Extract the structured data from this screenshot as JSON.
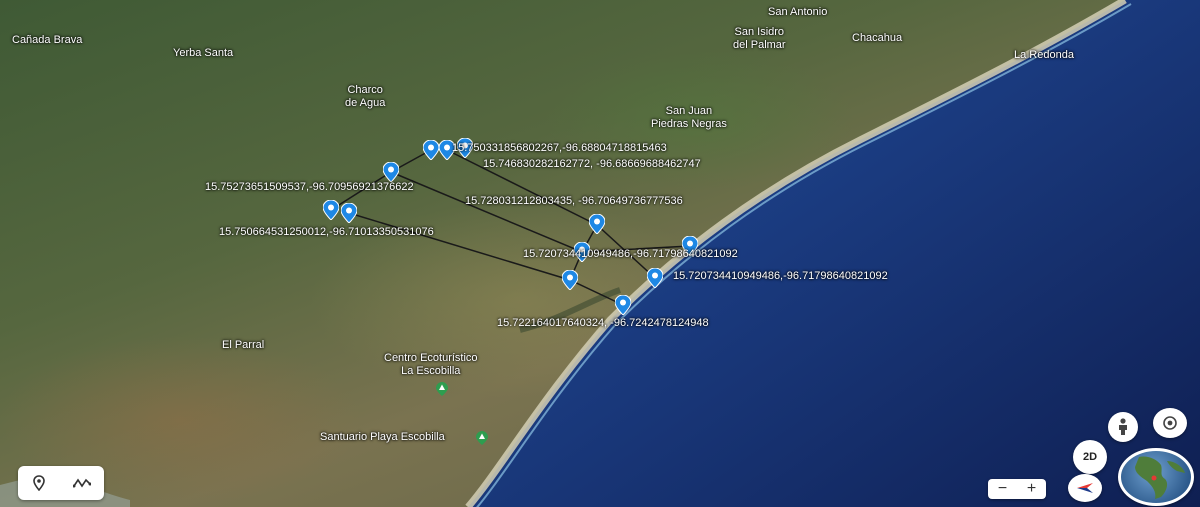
{
  "map": {
    "places": [
      {
        "id": "canada-brava",
        "text": "Cañada Brava"
      },
      {
        "id": "yerba-santa",
        "text": "Yerba Santa"
      },
      {
        "id": "charco-de-agua",
        "text": "Charco\nde Agua"
      },
      {
        "id": "san-antonio",
        "text": "San Antonio"
      },
      {
        "id": "san-isidro",
        "text": "San Isidro\ndel Palmar"
      },
      {
        "id": "chacahua",
        "text": "Chacahua"
      },
      {
        "id": "la-redonda",
        "text": "La Redonda"
      },
      {
        "id": "san-juan",
        "text": "San Juan\nPiedras Negras"
      },
      {
        "id": "el-parral",
        "text": "El Parral"
      },
      {
        "id": "centro-ecoturistico",
        "text": "Centro Ecoturístico\nLa Escobilla"
      },
      {
        "id": "santuario",
        "text": "Santuario Playa Escobilla"
      }
    ],
    "markers": [
      {
        "id": "m1",
        "label": "15.750331856802267,-96.68804718815463"
      },
      {
        "id": "m2",
        "label": "15.746830282162772, -96.68669688462747"
      },
      {
        "id": "m3",
        "label": "15.75273651509537,-96.70956921376622"
      },
      {
        "id": "m4",
        "label": "15.728031212803435, -96.70649736777536"
      },
      {
        "id": "m5",
        "label": "15.750664531250012,-96.71013350531076"
      },
      {
        "id": "m6",
        "label": "15.720734410949486,-96.71798640821092"
      },
      {
        "id": "m7",
        "label": "15.720734410949486,-96.71798640821092"
      },
      {
        "id": "m8",
        "label": "15.722164017640324, -96.7242478124948"
      }
    ]
  },
  "controls": {
    "view_2d_label": "2D",
    "zoom_out_label": "−",
    "zoom_in_label": "+"
  },
  "colors": {
    "marker": "#1e88e5",
    "route": "#1a1a1a",
    "land": "#56673f",
    "sea_deep": "#14285e",
    "sea_shallow": "#1f5a9a",
    "beach": "#c9c2a6"
  }
}
